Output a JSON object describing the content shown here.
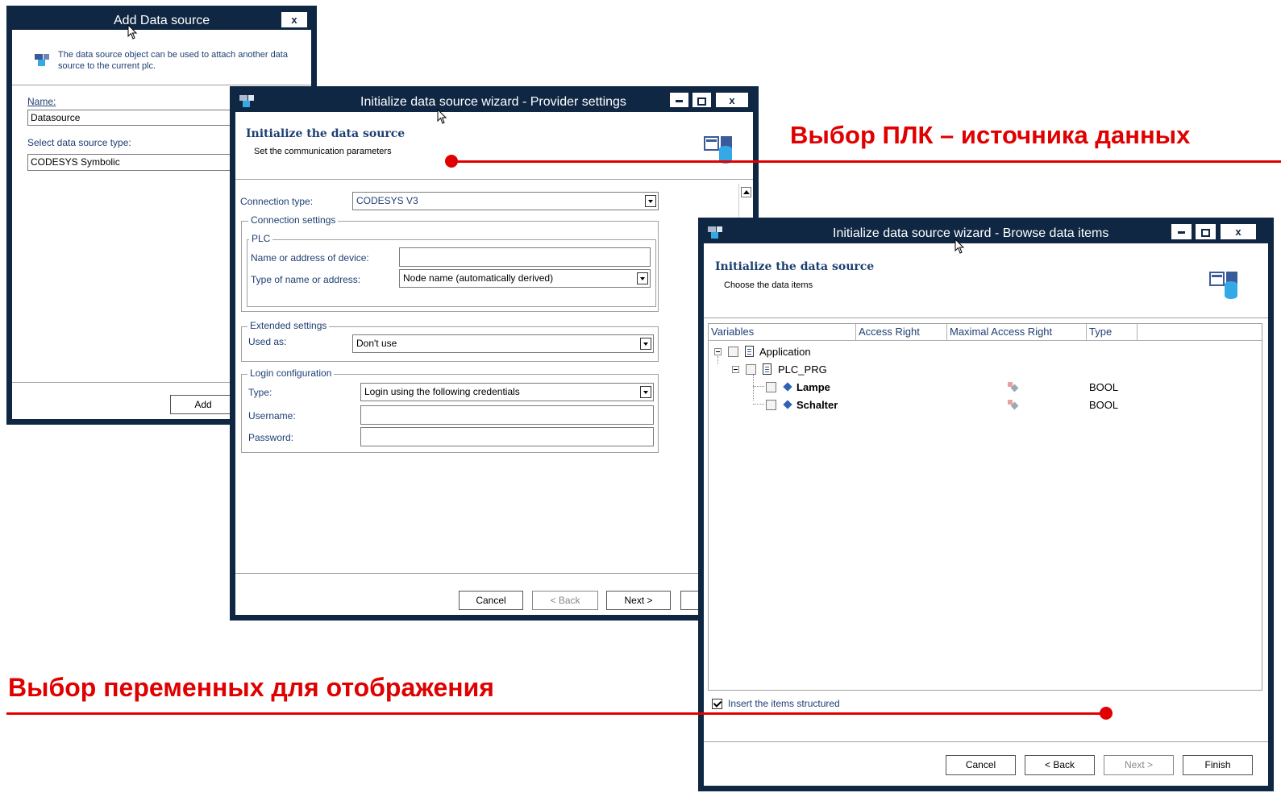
{
  "add_dialog": {
    "title": "Add Data source",
    "close": "x",
    "description": "The data source object can be used to attach another data source to the current plc.",
    "name_label": "Name:",
    "name_value": "Datasource",
    "type_label": "Select data source type:",
    "type_value": "CODESYS Symbolic",
    "add_button": "Add"
  },
  "provider_wizard": {
    "title": "Initialize data source wizard - Provider settings",
    "header_title": "Initialize the data source",
    "header_subtitle": "Set the communication parameters",
    "connection_type_label": "Connection type:",
    "connection_type_value": "CODESYS V3",
    "connection_settings_group": "Connection settings",
    "plc_group": "PLC",
    "device_label": "Name or address of device:",
    "device_value": "",
    "address_type_label": "Type of name or address:",
    "address_type_value": "Node name (automatically derived)",
    "extended_group": "Extended settings",
    "used_as_label": "Used as:",
    "used_as_value": "Don't use",
    "login_group": "Login configuration",
    "login_type_label": "Type:",
    "login_type_value": "Login using the following credentials",
    "username_label": "Username:",
    "username_value": "",
    "password_label": "Password:",
    "password_value": "",
    "cancel": "Cancel",
    "back": "< Back",
    "next": "Next >"
  },
  "browse_wizard": {
    "title": "Initialize data source wizard - Browse data items",
    "header_title": "Initialize the data source",
    "header_subtitle": "Choose the data items",
    "columns": [
      "Variables",
      "Access Right",
      "Maximal Access Right",
      "Type"
    ],
    "tree": {
      "root": "Application",
      "program": "PLC_PRG",
      "items": [
        {
          "name": "Lampe",
          "type": "BOOL"
        },
        {
          "name": "Schalter",
          "type": "BOOL"
        }
      ]
    },
    "insert_structured": "Insert the items structured",
    "cancel": "Cancel",
    "back": "< Back",
    "next": "Next >",
    "finish": "Finish"
  },
  "annotations": {
    "plc_source": "Выбор ПЛК – источника данных",
    "variables": "Выбор переменных для отображения"
  },
  "colors": {
    "titlebar": "#0f2743",
    "accent_text": "#1e3f73",
    "annotation": "#e00000"
  }
}
